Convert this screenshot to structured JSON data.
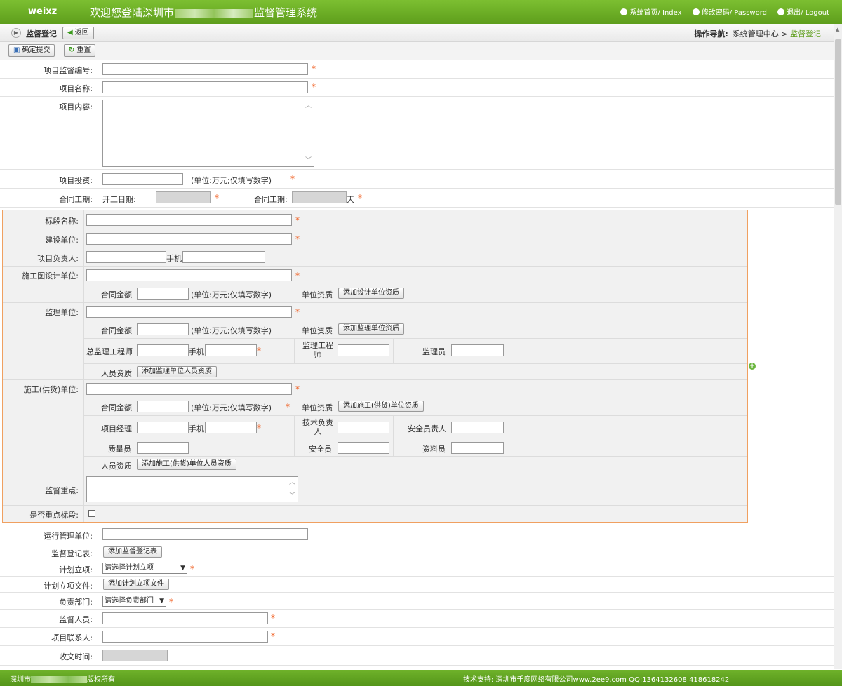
{
  "header": {
    "logo": "weixz",
    "welcome_prefix": "欢迎您登陆深圳市",
    "welcome_suffix": "监督管理系统",
    "links": [
      {
        "icon": "ie-icon",
        "label": "系统首页/",
        "sub": "Index"
      },
      {
        "icon": "gear-icon",
        "label": "修改密码/",
        "sub": "Password"
      },
      {
        "icon": "power-icon",
        "label": "退出/",
        "sub": "Logout"
      }
    ]
  },
  "toolbar": {
    "page_title": "监督登记",
    "back_label": "返回",
    "nav_label": "操作导航:",
    "nav_center": "系统管理中心",
    "nav_sep": ">",
    "nav_current": "监督登记",
    "submit_label": "确定提交",
    "reset_label": "重置"
  },
  "form": {
    "project_code": "项目监督编号:",
    "project_name": "项目名称:",
    "project_content": "项目内容:",
    "investment": "项目投资:",
    "investment_unit": "(单位:万元;仅填写数字)",
    "contract_period": "合同工期:",
    "start_date": "开工日期:",
    "contract_days": "合同工期:",
    "days_unit": "天"
  },
  "section": {
    "bid_name": "标段名称:",
    "builder": "建设单位:",
    "project_manager": "项目负责人:",
    "phone": "手机",
    "design_unit": "施工图设计单位:",
    "contract_amount": "合同金额",
    "amount_unit": "(单位:万元;仅填写数字)",
    "unit_qualification": "单位资质",
    "add_design_qual": "添加设计单位资质",
    "supervision_unit": "监理单位:",
    "add_supervision_qual": "添加监理单位资质",
    "chief_engineer": "总监理工程师",
    "supervision_engineer_l1": "监理工程",
    "supervision_engineer_l2": "师",
    "supervisor": "监理员",
    "personnel_qual": "人员资质",
    "add_supervision_personnel": "添加监理单位人员资质",
    "construction_unit": "施工(供货)单位:",
    "add_construction_qual": "添加施工(供货)单位资质",
    "pm": "项目经理",
    "tech_lead_l1": "技术负责",
    "tech_lead_l2": "人",
    "safety_lead": "安全员责人",
    "quality_officer": "质量员",
    "safety_officer": "安全员",
    "document_officer": "资料员",
    "add_construction_personnel": "添加施工(供货)单位人员资质",
    "focus": "监督重点:",
    "key_bid": "是否重点标段:"
  },
  "form2": {
    "ops_unit": "运行管理单位:",
    "register_table": "监督登记表:",
    "add_register": "添加监督登记表",
    "plan": "计划立项:",
    "plan_select": "请选择计划立项",
    "plan_file": "计划立项文件:",
    "add_plan_file": "添加计划立项文件",
    "dept": "负责部门:",
    "dept_select": "请选择负责部门",
    "inspector": "监督人员:",
    "contact": "项目联系人:",
    "receive_time": "收文时间:"
  },
  "footer": {
    "left_prefix": "深圳市",
    "left_suffix": "版权所有",
    "right": "技术支持: 深圳市千度网络有限公司www.2ee9.com QQ:1364132608 418618242"
  },
  "required_mark": "*",
  "colors": {
    "brand": "#6ab12a",
    "accent": "#f05a1b",
    "frame": "#f0a060"
  }
}
